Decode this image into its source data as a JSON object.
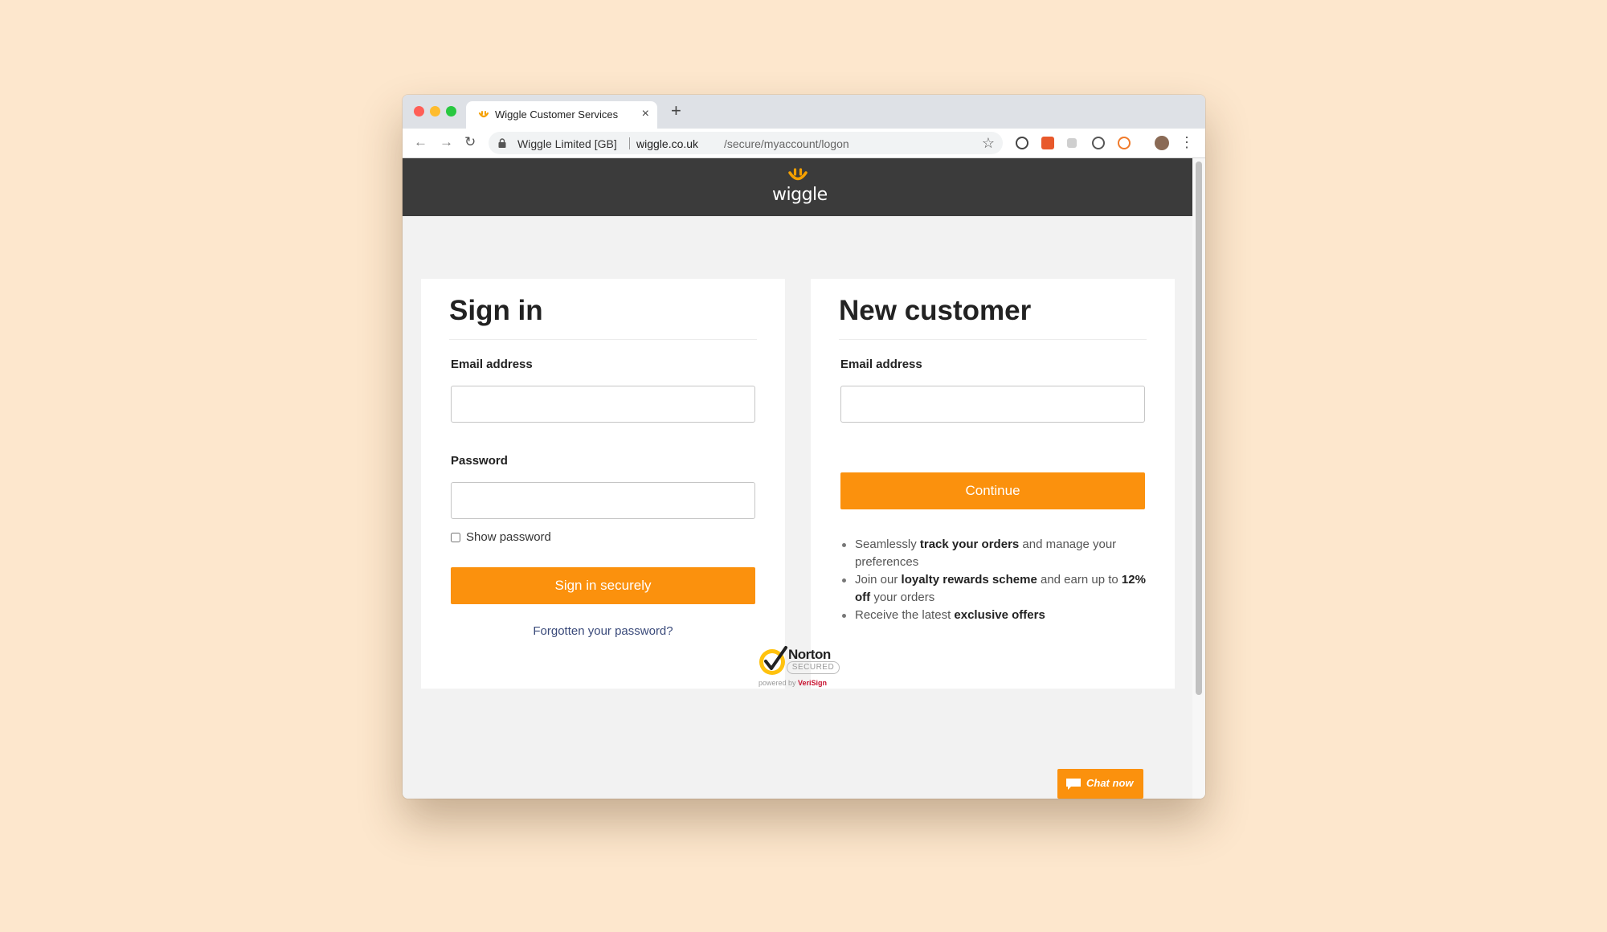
{
  "browser": {
    "tab_title": "Wiggle Customer Services",
    "tab_close": "×",
    "new_tab": "+",
    "site_identity": "Wiggle Limited [GB]",
    "url_domain": "wiggle.co.uk",
    "url_path": "/secure/myaccount/logon",
    "icons": [
      "back-icon",
      "forward-icon",
      "reload-icon",
      "lock-icon",
      "star-icon",
      "info-extension-icon",
      "r-extension-icon",
      "grey-extension-icon",
      "shield-extension-icon",
      "orange-extension-icon",
      "profile-avatar",
      "kebab-menu-icon"
    ]
  },
  "header": {
    "logo_text": "wiggle",
    "bg_color": "#3b3b3b"
  },
  "sign_in": {
    "title": "Sign in",
    "email_label": "Email address",
    "email_value": "",
    "password_label": "Password",
    "password_value": "",
    "show_password_label": "Show password",
    "submit_label": "Sign in securely",
    "forgot_label": "Forgotten your password?"
  },
  "new_customer": {
    "title": "New customer",
    "email_label": "Email address",
    "email_value": "",
    "continue_label": "Continue",
    "benefits": [
      {
        "pre": "Seamlessly ",
        "bold": "track your orders",
        "post": " and manage your preferences",
        "bold2": "",
        "post2": ""
      },
      {
        "pre": "Join our ",
        "bold": "loyalty rewards scheme",
        "post": " and earn up to ",
        "bold2": "12% off",
        "post2": " your orders"
      },
      {
        "pre": "Receive the latest ",
        "bold": "exclusive offers",
        "post": "",
        "bold2": "",
        "post2": ""
      }
    ]
  },
  "norton": {
    "word": "Norton",
    "secured": "SECURED",
    "powered_by": "powered by ",
    "verisign": "VeriSign"
  },
  "chat": {
    "label": "Chat now"
  },
  "colors": {
    "accent": "#fb910d",
    "page_bg": "#fde7cd",
    "link": "#3a4a7a"
  }
}
